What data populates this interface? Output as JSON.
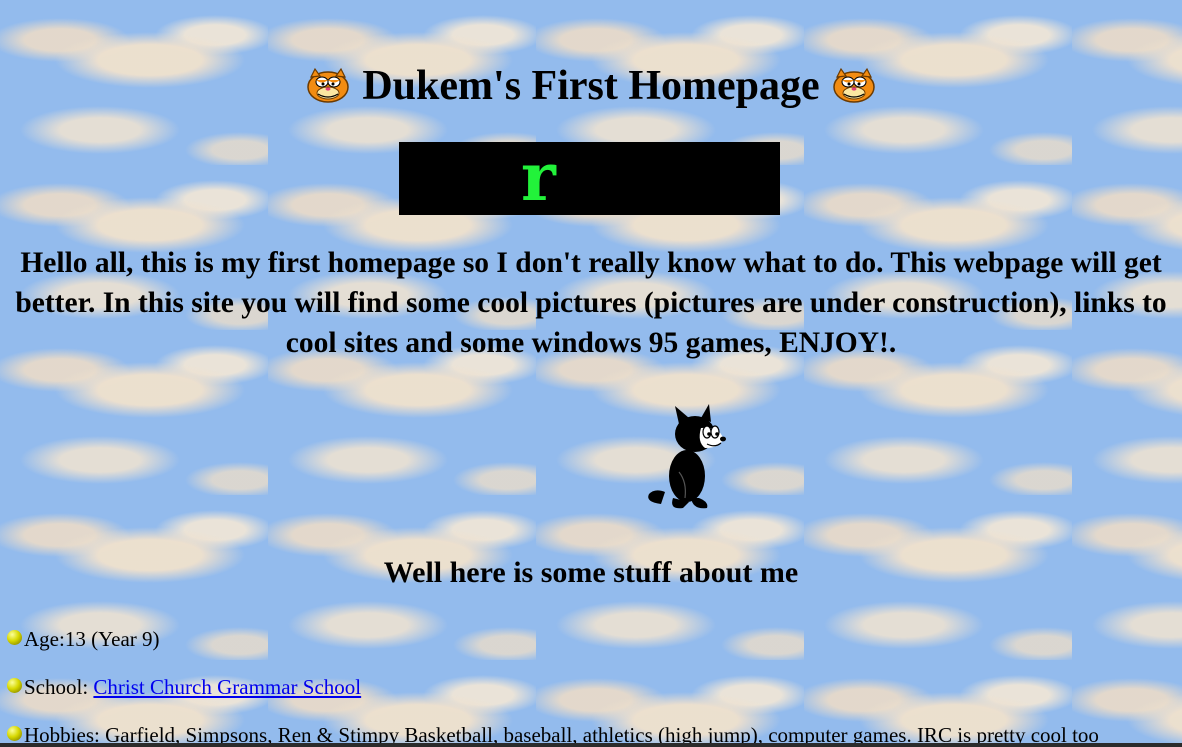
{
  "header": {
    "title": "Dukem's First Homepage",
    "left_icon": "garfield-icon",
    "right_icon": "garfield-icon"
  },
  "marquee": {
    "visible_text": "r",
    "background_color": "#000000",
    "text_color": "#22f23a"
  },
  "intro": {
    "text": "Hello all, this is my first homepage so I don't really know what to do. This webpage will get better. In this site you will find some cool pictures (pictures are under construction), links to cool sites and some windows 95 games, ENJOY!."
  },
  "mascot": {
    "icon": "felix-the-cat-icon"
  },
  "about": {
    "heading": "Well here is some stuff about me",
    "items": {
      "age": {
        "text": "Age:13 (Year 9)"
      },
      "school": {
        "label": "School: ",
        "link_text": "Christ Church Grammar School"
      },
      "hobbies": {
        "text": "Hobbies: Garfield, Simpsons, Ren & Stimpy Basketball, baseball, athletics (high jump), computer games. IRC is pretty cool too"
      }
    },
    "bullet_icon": "yellow-ball-bullet-icon"
  },
  "colors": {
    "background_sky": "#93bbed",
    "link": "#0000ee"
  }
}
